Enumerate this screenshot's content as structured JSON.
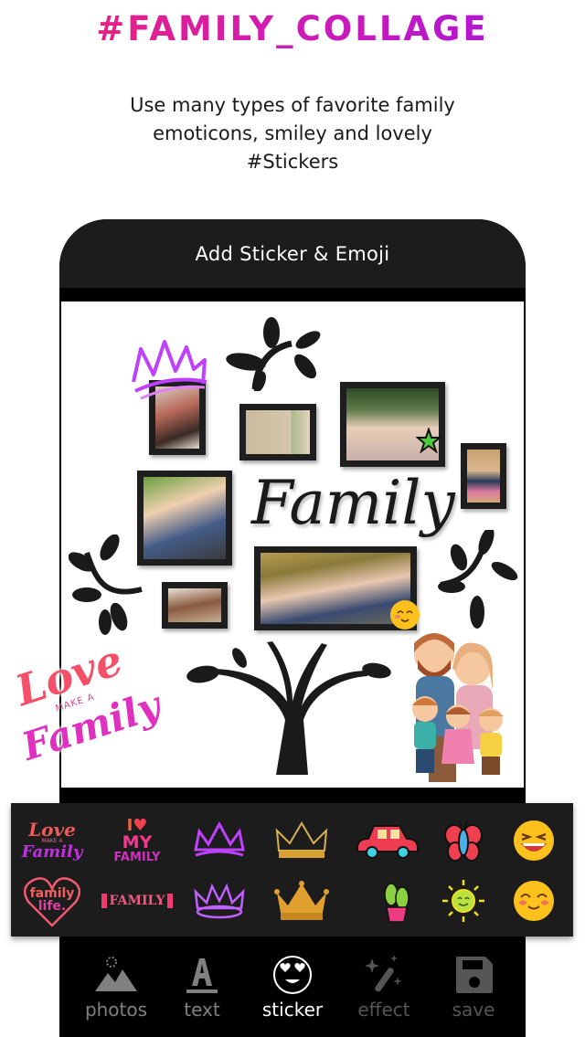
{
  "headline": "#FAMILY_COLLAGE",
  "subtitle": {
    "line1": "Use many types of favorite family",
    "line2": "emoticons, smiley and lovely",
    "line3": "#Stickers"
  },
  "screen": {
    "title": "Add Sticker & Emoji",
    "canvas": {
      "word_art": "Family",
      "stickers_on_canvas": [
        "neon-crown",
        "star",
        "smiley-blush",
        "cartoon-family"
      ]
    },
    "overlay_sticker": {
      "line1": "Love",
      "line2": "MAKE A",
      "line3": "Family"
    }
  },
  "sticker_panel": {
    "row1": [
      {
        "name": "love-make-a-family",
        "text1": "Love",
        "text2": "MAKE A",
        "text3": "Family"
      },
      {
        "name": "i-love-my-family",
        "text1": "I",
        "text2": "MY",
        "text3": "FAMILY"
      },
      {
        "name": "neon-crown-purple"
      },
      {
        "name": "gold-outline-crown"
      },
      {
        "name": "red-car"
      },
      {
        "name": "butterfly"
      },
      {
        "name": "laughing-emoji"
      }
    ],
    "row2": [
      {
        "name": "family-life-heart",
        "text1": "family",
        "text2": "life."
      },
      {
        "name": "family-banner",
        "text1": "FAMILY"
      },
      {
        "name": "neon-crown-pink"
      },
      {
        "name": "gold-crown"
      },
      {
        "name": "cactus"
      },
      {
        "name": "sun"
      },
      {
        "name": "blushing-emoji"
      }
    ]
  },
  "bottom_nav": [
    {
      "label": "photos",
      "icon": "mountain-sun-icon",
      "state": "normal"
    },
    {
      "label": "text",
      "icon": "text-a-icon",
      "state": "normal"
    },
    {
      "label": "sticker",
      "icon": "heart-eyes-smiley-icon",
      "state": "active"
    },
    {
      "label": "effect",
      "icon": "magic-wand-icon",
      "state": "dim"
    },
    {
      "label": "save",
      "icon": "floppy-disk-icon",
      "state": "dim"
    }
  ],
  "colors": {
    "headline_start": "#f0246a",
    "headline_end": "#a613e0",
    "phone_header": "#1c1c1c",
    "panel_bg": "#1c1c1c",
    "nav_active": "#ffffff",
    "nav_inactive": "#808080"
  }
}
